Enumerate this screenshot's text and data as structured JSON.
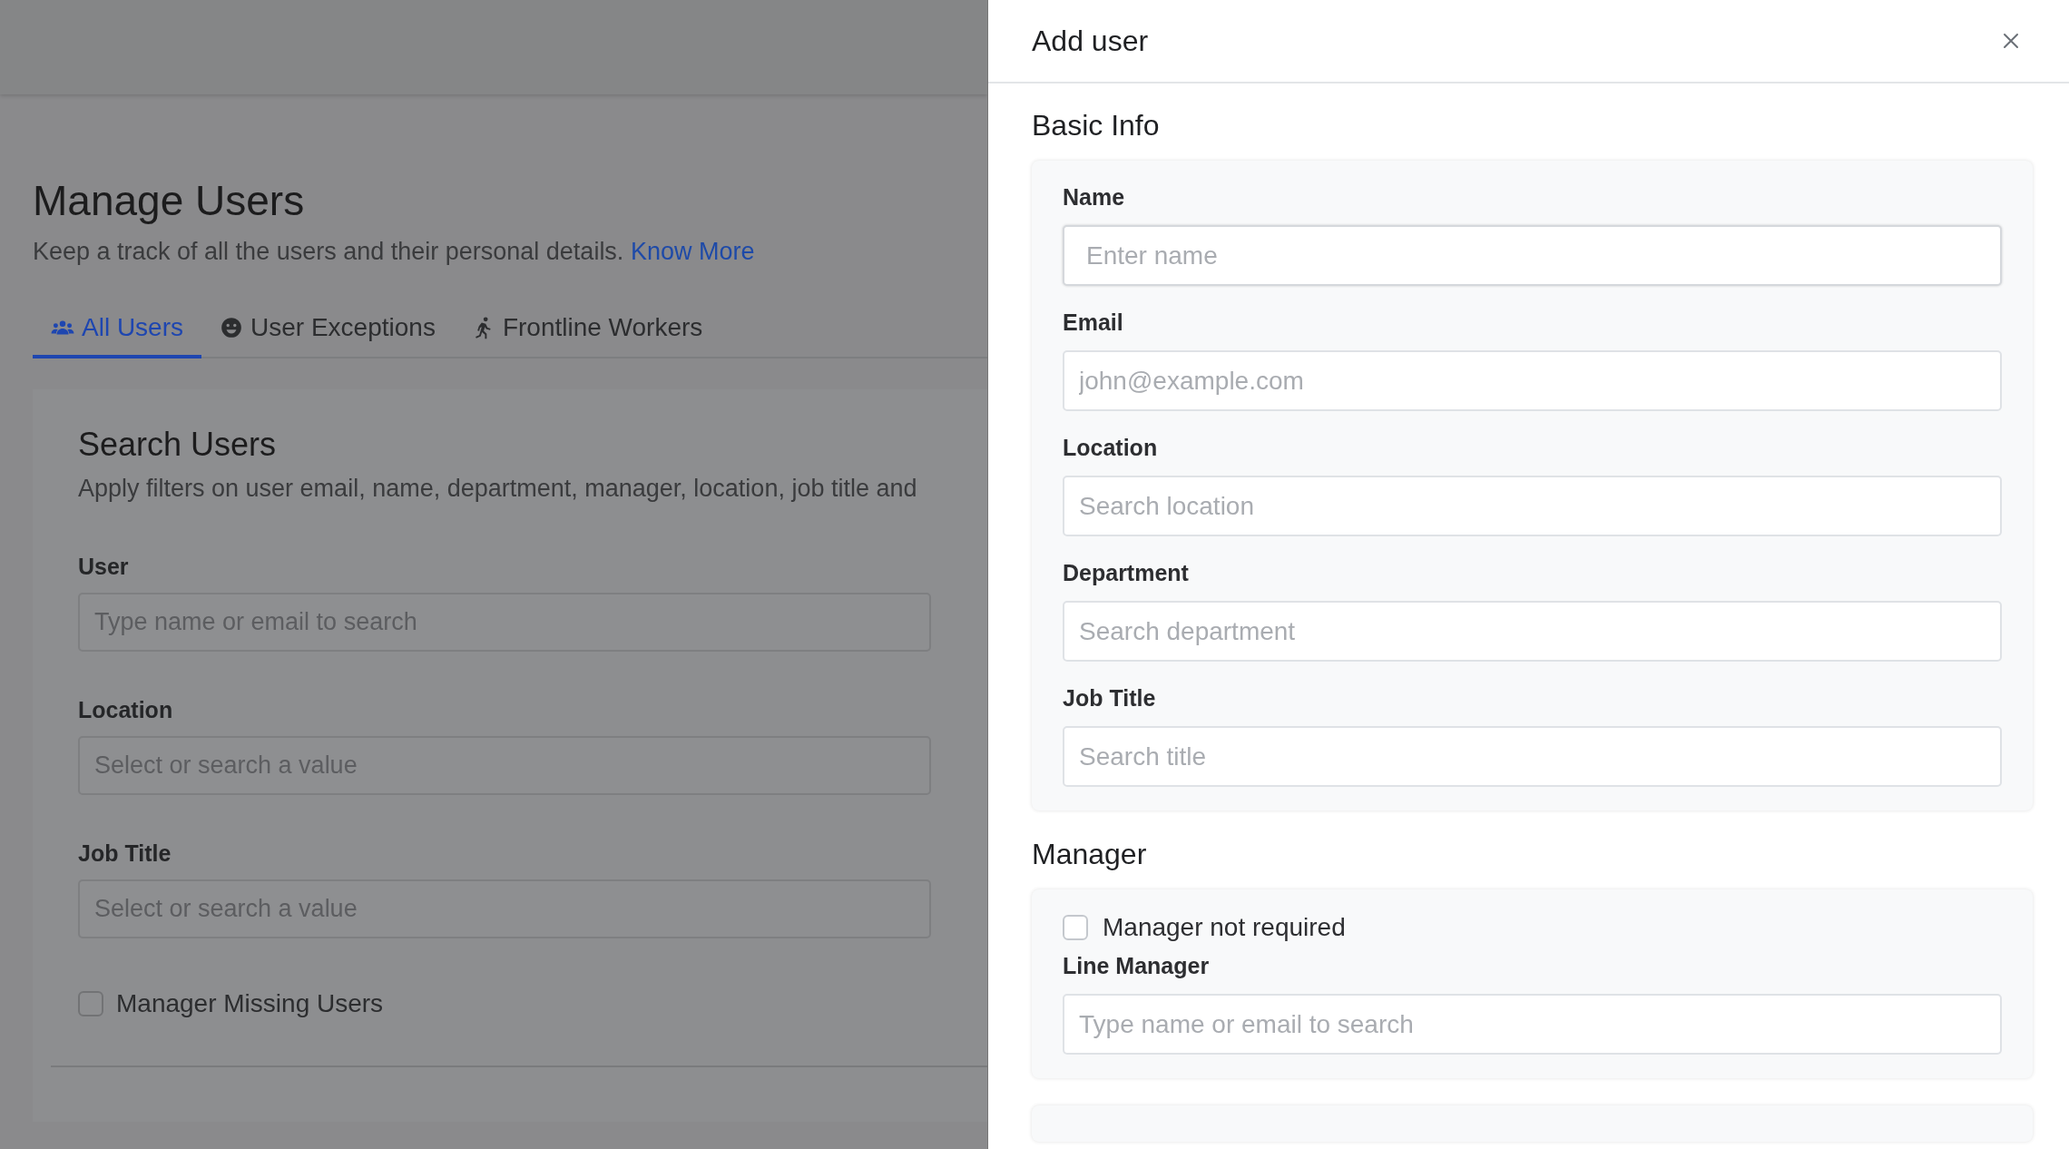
{
  "page": {
    "title": "Manage Users",
    "subtitle": "Keep a track of all the users and their personal details.",
    "link": "Know More",
    "tabs": [
      {
        "label": "All Users",
        "selected": true
      },
      {
        "label": "User Exceptions",
        "selected": false
      },
      {
        "label": "Frontline Workers",
        "selected": false
      }
    ],
    "search_panel": {
      "title": "Search Users",
      "description": "Apply filters on user email, name, department, manager, location, job title and",
      "filters": [
        {
          "label": "User",
          "placeholder": "Type name or email to search"
        },
        {
          "label": "Location",
          "placeholder": "Select or search a value"
        },
        {
          "label": "Job Title",
          "placeholder": "Select or search a value"
        }
      ],
      "checkbox": {
        "label": "Manager Missing Users",
        "checked": false
      }
    }
  },
  "drawer": {
    "title": "Add user",
    "sections": [
      {
        "title": "Basic Info",
        "items": [
          {
            "kind": "field",
            "label": "Name",
            "placeholder": "Enter name",
            "focused": true
          },
          {
            "kind": "field",
            "label": "Email",
            "placeholder": "john@example.com",
            "focused": false
          },
          {
            "kind": "field",
            "label": "Location",
            "placeholder": "Search location",
            "focused": false
          },
          {
            "kind": "field",
            "label": "Department",
            "placeholder": "Search department",
            "focused": false
          },
          {
            "kind": "field",
            "label": "Job Title",
            "placeholder": "Search title",
            "focused": false
          }
        ]
      },
      {
        "title": "Manager",
        "items": [
          {
            "kind": "checkbox",
            "label": "Manager not required",
            "checked": false
          },
          {
            "kind": "field",
            "label": "Line Manager",
            "placeholder": "Type name or email to search",
            "focused": false
          }
        ]
      }
    ]
  }
}
